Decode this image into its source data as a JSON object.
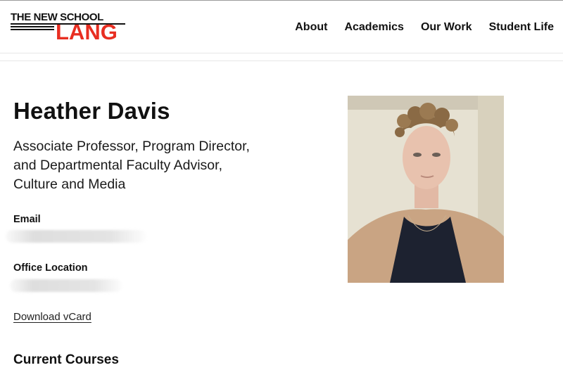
{
  "header": {
    "logo": {
      "top_text": "THE NEW SCHOOL",
      "main_text": "LANG",
      "brand_color": "#e82e21"
    },
    "nav": [
      "About",
      "Academics",
      "Our Work",
      "Student Life"
    ]
  },
  "profile": {
    "name": "Heather Davis",
    "title": "Associate Professor, Program Director, and Departmental Faculty Advisor, Culture and Media",
    "email_label": "Email",
    "office_label": "Office Location",
    "vcard_link": "Download vCard",
    "courses_heading": "Current Courses"
  }
}
